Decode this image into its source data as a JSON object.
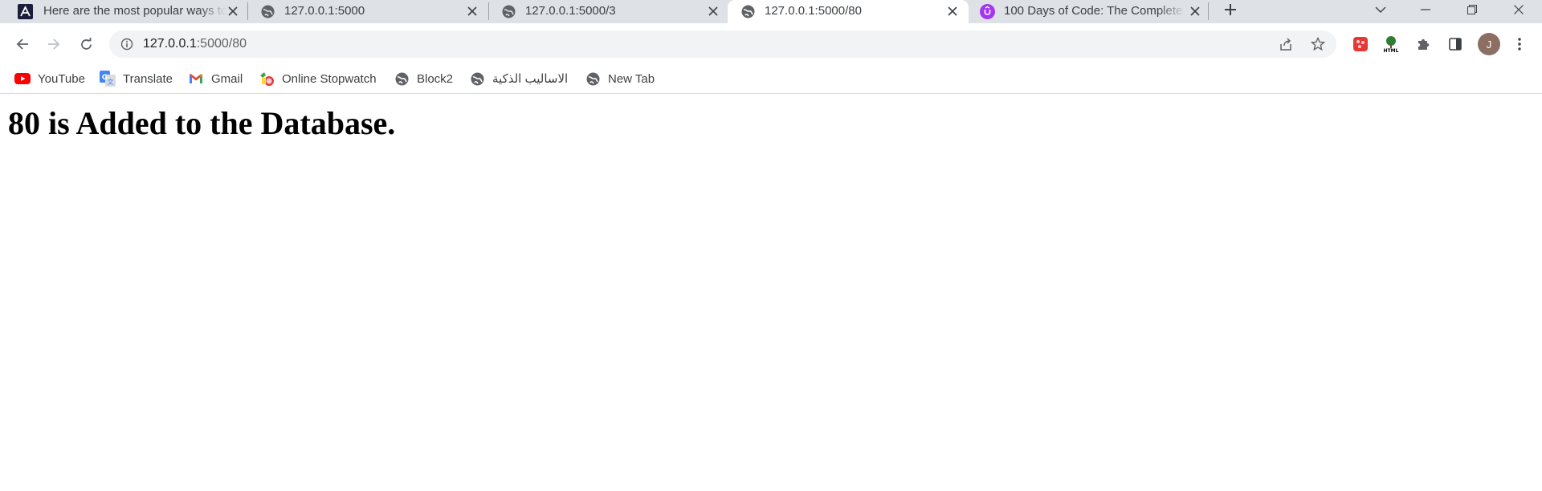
{
  "tabs": [
    {
      "title": "Here are the most popular ways to",
      "favicon": "logo-icon",
      "active": false
    },
    {
      "title": "127.0.0.1:5000",
      "favicon": "globe-icon",
      "active": false
    },
    {
      "title": "127.0.0.1:5000/3",
      "favicon": "globe-icon",
      "active": false
    },
    {
      "title": "127.0.0.1:5000/80",
      "favicon": "globe-icon",
      "active": true
    },
    {
      "title": "100 Days of Code: The Complete",
      "favicon": "udemy-icon",
      "active": false
    }
  ],
  "address_bar": {
    "host": "127.0.0.1",
    "path": ":5000/80"
  },
  "bookmarks": [
    {
      "label": "YouTube",
      "icon": "youtube-icon"
    },
    {
      "label": "Translate",
      "icon": "translate-icon"
    },
    {
      "label": "Gmail",
      "icon": "gmail-icon"
    },
    {
      "label": "Online Stopwatch",
      "icon": "stopwatch-icon"
    },
    {
      "label": "Block2",
      "icon": "globe-icon"
    },
    {
      "label": "الاساليب الذكية",
      "icon": "globe-icon"
    },
    {
      "label": "New Tab",
      "icon": "globe-icon"
    }
  ],
  "profile": {
    "initial": "J"
  },
  "page": {
    "heading": "80 is Added to the Database."
  },
  "colors": {
    "tabstrip": "#dee1e6",
    "omnibox": "#f1f3f4",
    "udemy": "#a435f0",
    "youtube": "#ff0000"
  }
}
